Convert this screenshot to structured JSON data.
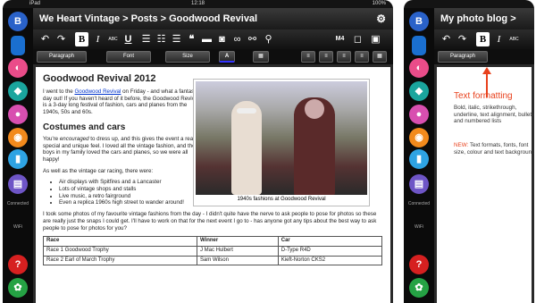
{
  "screen1": {
    "status": {
      "left": "iPad",
      "time": "12:18",
      "right": "100%"
    },
    "title": "We Heart Vintage > Posts > Goodwood Revival",
    "toolbar": {
      "undo": "↶",
      "redo": "↷",
      "bold": "B",
      "italic": "I",
      "abc": "ABC",
      "underline": "U",
      "quote": "❝",
      "m4": "M4"
    },
    "selects": {
      "paragraph": "Paragraph",
      "font": "Font",
      "size": "Size"
    },
    "sidebar_label_connected": "Connected",
    "sidebar_label_wifi": "WiFi",
    "doc": {
      "h1": "Goodwood Revival 2012",
      "p1_pre": "I went to the ",
      "p1_link": "Goodwood Revival",
      "p1_post": " on Friday - and what a fantastic day out! If you haven't heard of it before, the Goodwood Revival is a 3-day long festival of fashion, cars and planes from the 1940s, 50s and 60s.",
      "h2": "Costumes and cars",
      "p2_pre": "You're ",
      "p2_em": "encouraged",
      "p2_post": " to dress up, and this gives the event a really special and unique feel. I loved all the vintage fashion, and the boys in my family loved the cars and planes, so we were all happy!",
      "p3": "As well as the vintage car racing, there were:",
      "list": [
        "Air displays with Spitfires and a Lancaster",
        "Lots of vintage shops and stalls",
        "Live music, a retro fairground",
        "Even a replica 1960s high street to wander around!"
      ],
      "caption": "1940s fashions at Goodwood Revival",
      "p4": "I took some photos of my favourite vintage fashions from the day - I didn't quite have the nerve to ask people to pose for photos so these are really just the snaps I could get. I'll have to work on that for the next event I go to - has anyone got any tips about the best way to ask people to pose for photos for you?",
      "table": [
        [
          "Race",
          "Winner",
          "Car"
        ],
        [
          "Race 1 Goodwood Trophy",
          "J Mac Hulbert",
          "D-Type R4D"
        ],
        [
          "Race 2 Earl of March Trophy",
          "Sam Wilson",
          "Kieft-Norton CKS2"
        ]
      ]
    }
  },
  "screen2": {
    "title": "My photo blog > Posts >",
    "toolbar": {
      "undo": "↶",
      "redo": "↷",
      "bold": "B",
      "italic": "I",
      "abc": "ABC"
    },
    "selects": {
      "paragraph": "Paragraph"
    },
    "annotation_title": "Text formatting",
    "annotation_body": "Bold, italic, strikethrough, underline, text alignment, bulleted and numbered lists",
    "annotation_new_label": "NEW:",
    "annotation_new_body": " Text formats, fonts, font size, colour and text background",
    "sidebar_label_connected": "Connected",
    "sidebar_label_wifi": "WiFi"
  },
  "colors": {
    "accent_red": "#e8411c",
    "icon_blue": "#2a62c9",
    "icon_green": "#25a244"
  }
}
